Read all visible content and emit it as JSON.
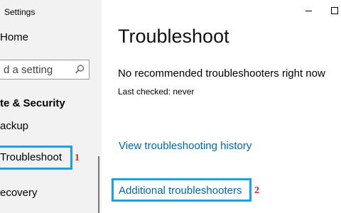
{
  "window": {
    "title": "Settings",
    "controls": {
      "minimize_icon": "minimize-icon",
      "maximize_icon": "maximize-icon"
    }
  },
  "sidebar": {
    "home_label": "Home",
    "search": {
      "placeholder": "Find a setting",
      "visible_text": "d a setting",
      "icon": "search-icon"
    },
    "section_title": "te & Security",
    "items": [
      {
        "label": "ackup"
      },
      {
        "label": "Troubleshoot",
        "selected": true
      },
      {
        "label": "ecovery"
      }
    ]
  },
  "main": {
    "title": "Troubleshoot",
    "status": "No recommended troubleshooters right now",
    "last_checked": "Last checked: never",
    "links": [
      {
        "label": "View troubleshooting history"
      },
      {
        "label": "Additional troubleshooters"
      }
    ]
  },
  "annotations": [
    {
      "number": "1",
      "target": "Troubleshoot"
    },
    {
      "number": "2",
      "target": "Additional troubleshooters"
    }
  ],
  "colors": {
    "link": "#0066b4",
    "highlight_box": "#1ba1e2",
    "marker": "#d32222",
    "sidebar_bg": "#f2f2f2"
  }
}
